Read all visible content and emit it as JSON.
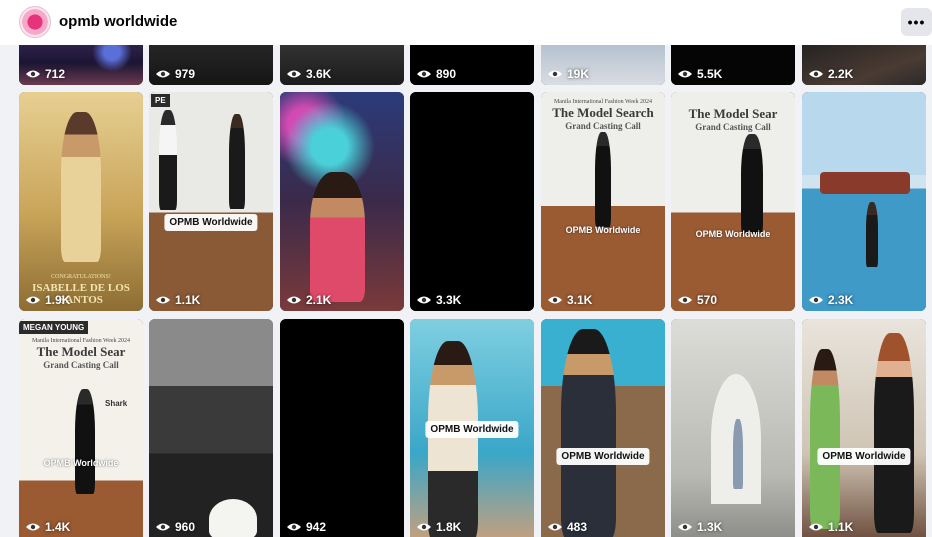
{
  "header": {
    "page_name": "opmb worldwide",
    "more_label": "•••"
  },
  "rows": {
    "top": [
      "712",
      "979",
      "3.6K",
      "890",
      "19K",
      "5.5K",
      "2.2K"
    ],
    "middle": [
      "1.9K",
      "1.1K",
      "2.1K",
      "3.3K",
      "3.1K",
      "570",
      "2.3K"
    ],
    "bottom": [
      "1.4K",
      "960",
      "942",
      "1.8K",
      "483",
      "1.3K",
      "1.1K"
    ]
  },
  "watermark": "OPMB Worldwide",
  "tile_text": {
    "congrats": "CONGRATULATIONS!",
    "isabelle": "ISABELLE DE LOS SANTOS",
    "fashion_week": "Manila International Fashion Week 2024",
    "model_search": "The Model Search",
    "casting_call": "Grand Casting Call",
    "megan_young": "MEGAN YOUNG",
    "sign": "PE",
    "model_sear": "The Model Sear",
    "shark": "Shark"
  },
  "icons": {
    "views": "eye-icon",
    "more": "more-options-icon"
  }
}
